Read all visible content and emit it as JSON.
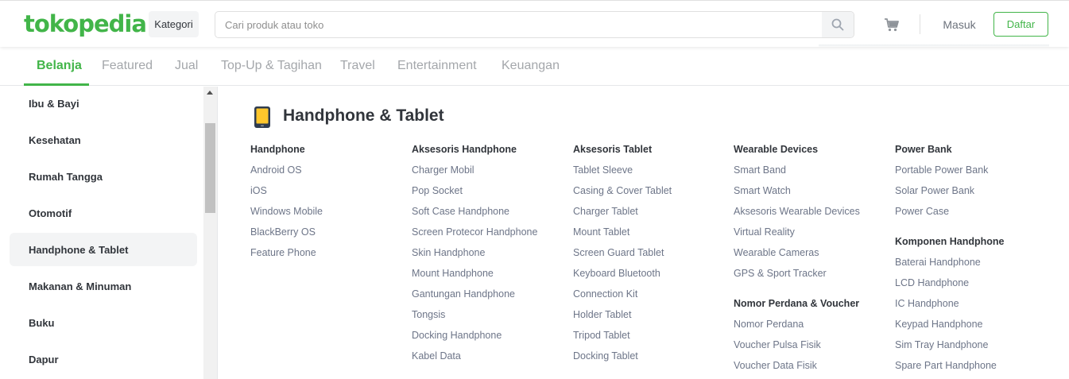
{
  "header": {
    "logo": "tokopedia",
    "kategori_label": "Kategori",
    "search_placeholder": "Cari produk atau toko",
    "search_value": "",
    "login_label": "Masuk",
    "register_label": "Daftar",
    "brand_color": "#42b549"
  },
  "tabs": [
    {
      "label": "Belanja",
      "active": true
    },
    {
      "label": "Featured",
      "active": false
    },
    {
      "label": "Jual",
      "active": false
    },
    {
      "label": "Top-Up & Tagihan",
      "active": false
    },
    {
      "label": "Travel",
      "active": false
    },
    {
      "label": "Entertainment",
      "active": false
    },
    {
      "label": "Keuangan",
      "active": false
    }
  ],
  "sidebar": {
    "items": [
      {
        "label": "Ibu & Bayi"
      },
      {
        "label": "Kesehatan"
      },
      {
        "label": "Rumah Tangga"
      },
      {
        "label": "Otomotif"
      },
      {
        "label": "Handphone & Tablet",
        "active": true
      },
      {
        "label": "Makanan & Minuman"
      },
      {
        "label": "Buku"
      },
      {
        "label": "Dapur"
      }
    ]
  },
  "content": {
    "title": "Handphone & Tablet",
    "icon": "phone-icon",
    "columns": [
      {
        "groups": [
          {
            "heading": "Handphone",
            "items": [
              "Android OS",
              "iOS",
              "Windows Mobile",
              "BlackBerry OS",
              "Feature Phone"
            ]
          }
        ]
      },
      {
        "groups": [
          {
            "heading": "Aksesoris Handphone",
            "items": [
              "Charger Mobil",
              "Pop Socket",
              "Soft Case Handphone",
              "Screen Protecor Handphone",
              "Skin Handphone",
              "Mount Handphone",
              "Gantungan Handphone",
              "Tongsis",
              "Docking Handphone",
              "Kabel Data"
            ]
          }
        ]
      },
      {
        "groups": [
          {
            "heading": "Aksesoris Tablet",
            "items": [
              "Tablet Sleeve",
              "Casing & Cover Tablet",
              "Charger Tablet",
              "Mount Tablet",
              "Screen Guard Tablet",
              "Keyboard Bluetooth",
              "Connection Kit",
              "Holder Tablet",
              "Tripod Tablet",
              "Docking Tablet"
            ]
          }
        ]
      },
      {
        "groups": [
          {
            "heading": "Wearable Devices",
            "items": [
              "Smart Band",
              "Smart Watch",
              "Aksesoris Wearable Devices",
              "Virtual Reality",
              "Wearable Cameras",
              "GPS & Sport Tracker"
            ]
          },
          {
            "heading": "Nomor Perdana & Voucher",
            "items": [
              "Nomor Perdana",
              "Voucher Pulsa Fisik",
              "Voucher Data Fisik"
            ]
          }
        ]
      },
      {
        "groups": [
          {
            "heading": "Power Bank",
            "items": [
              "Portable Power Bank",
              "Solar Power Bank",
              "Power Case"
            ]
          },
          {
            "heading": "Komponen Handphone",
            "items": [
              "Baterai Handphone",
              "LCD Handphone",
              "IC Handphone",
              "Keypad Handphone",
              "Sim Tray Handphone",
              "Spare Part Handphone"
            ]
          }
        ]
      }
    ]
  }
}
